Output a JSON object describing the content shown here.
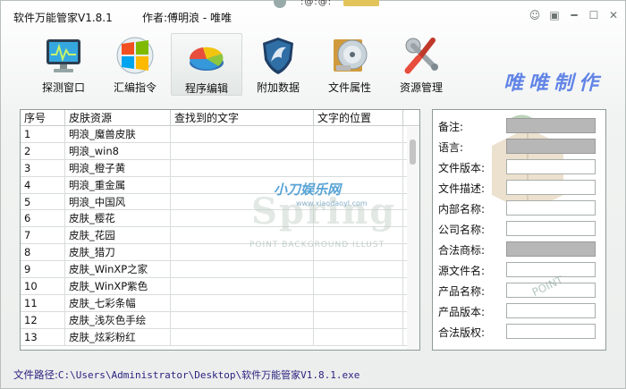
{
  "window": {
    "title": "软件万能管家V1.8.1",
    "author": "作者:傅明浪 - 唯唯",
    "top_text": ":@:@:",
    "brand": "唯唯制作"
  },
  "toolbar": [
    {
      "label": "探测窗口",
      "icon": "monitor-icon"
    },
    {
      "label": "汇编指令",
      "icon": "windows-logo-icon"
    },
    {
      "label": "程序编辑",
      "icon": "pie-chart-icon"
    },
    {
      "label": "附加数据",
      "icon": "shield-icon"
    },
    {
      "label": "文件属性",
      "icon": "disc-icon"
    },
    {
      "label": "资源管理",
      "icon": "tools-icon"
    }
  ],
  "table": {
    "headers": [
      "序号",
      "皮肤资源",
      "查找到的文字",
      "文字的位置"
    ],
    "rows": [
      [
        "1",
        "明浪_魔兽皮肤",
        "",
        ""
      ],
      [
        "2",
        "明浪_win8",
        "",
        ""
      ],
      [
        "3",
        "明浪_橙子黄",
        "",
        ""
      ],
      [
        "4",
        "明浪_重金属",
        "",
        ""
      ],
      [
        "5",
        "明浪_中国风",
        "",
        ""
      ],
      [
        "6",
        "皮肤_樱花",
        "",
        ""
      ],
      [
        "7",
        "皮肤_花园",
        "",
        ""
      ],
      [
        "8",
        "皮肤_猎刀",
        "",
        ""
      ],
      [
        "9",
        "皮肤_WinXP之家",
        "",
        ""
      ],
      [
        "10",
        "皮肤_WinXP紫色",
        "",
        ""
      ],
      [
        "11",
        "皮肤_七彩条幅",
        "",
        ""
      ],
      [
        "12",
        "皮肤_浅灰色手绘",
        "",
        ""
      ],
      [
        "13",
        "皮肤_炫彩粉红",
        "",
        ""
      ]
    ]
  },
  "watermark": {
    "title": "小刀娱乐网",
    "sub": "www.xiaodaoyl.com",
    "big": "Spring",
    "line": "POINT BACKGROUND ILLUST",
    "point": "POINT"
  },
  "properties": [
    {
      "label": "备注:",
      "value": "",
      "disabled": true
    },
    {
      "label": "语言:",
      "value": "",
      "disabled": true
    },
    {
      "label": "文件版本:",
      "value": "",
      "disabled": false
    },
    {
      "label": "文件描述:",
      "value": "",
      "disabled": false
    },
    {
      "label": "内部名称:",
      "value": "",
      "disabled": false
    },
    {
      "label": "公司名称:",
      "value": "",
      "disabled": false
    },
    {
      "label": "合法商标:",
      "value": "",
      "disabled": true
    },
    {
      "label": "源文件名:",
      "value": "",
      "disabled": false
    },
    {
      "label": "产品名称:",
      "value": "",
      "disabled": false
    },
    {
      "label": "产品版本:",
      "value": "",
      "disabled": false
    },
    {
      "label": "合法版权:",
      "value": "",
      "disabled": false
    }
  ],
  "status": {
    "path_label": "文件路径:",
    "path_value": "C:\\Users\\Administrator\\Desktop\\软件万能管家V1.8.1.exe"
  }
}
